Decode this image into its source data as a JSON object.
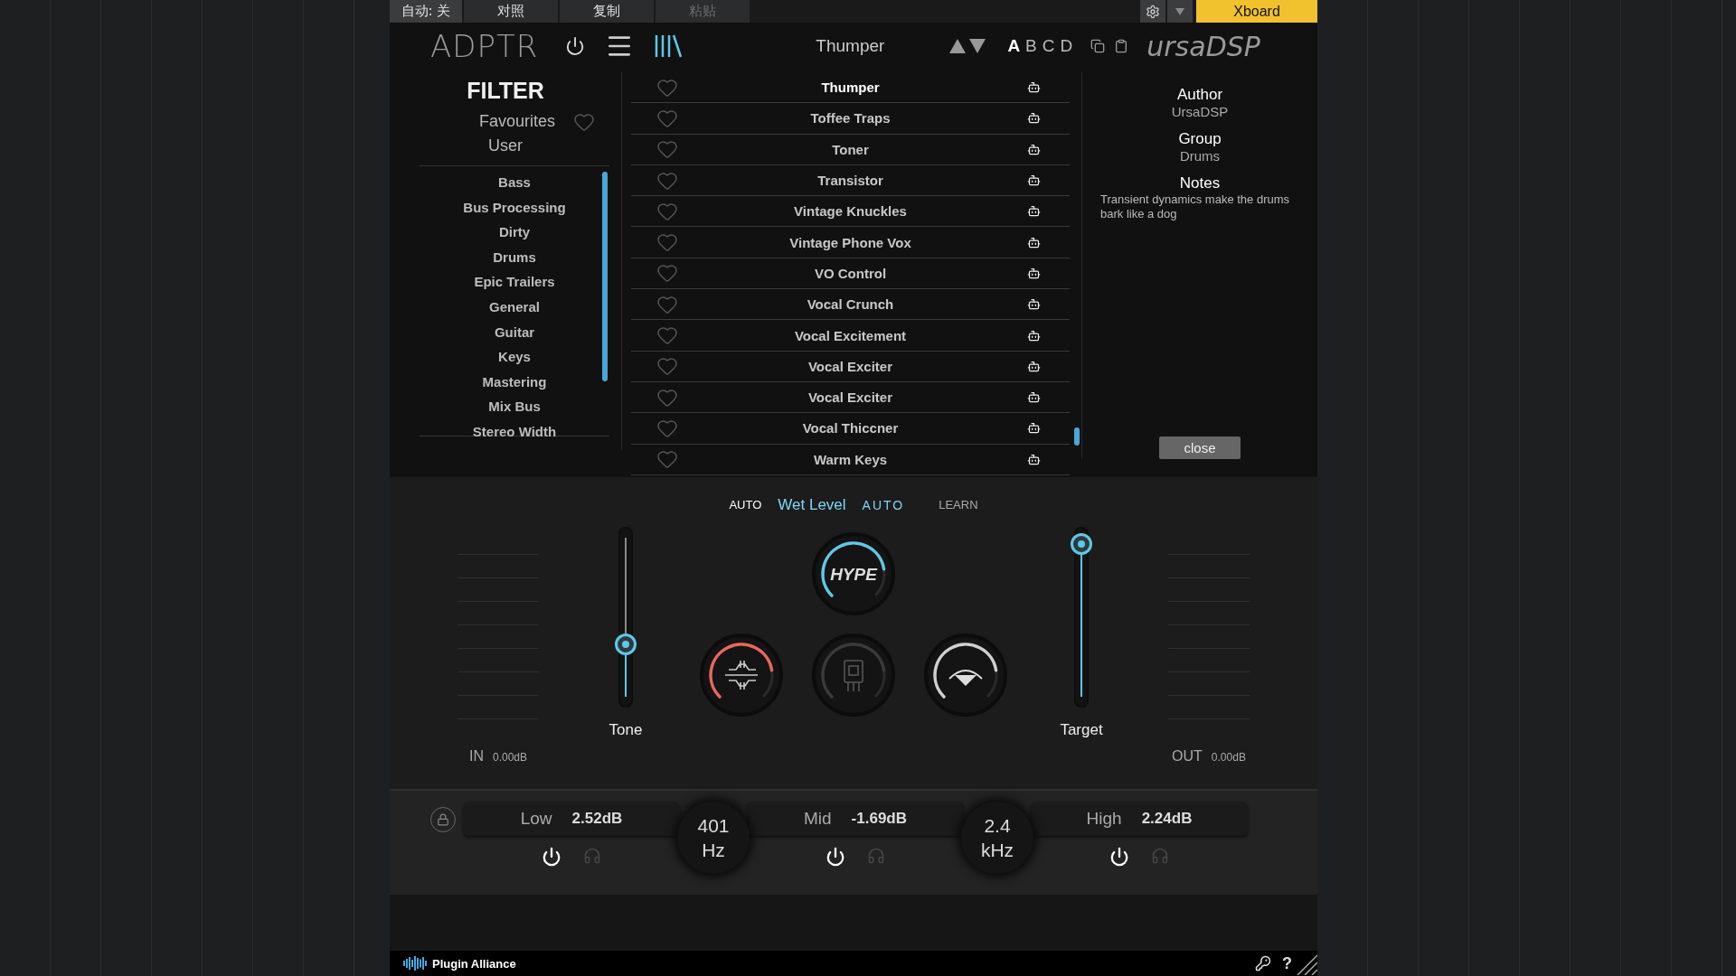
{
  "host_bar": {
    "items": [
      {
        "label": "自动: 关",
        "disabled": false
      },
      {
        "label": "对照",
        "disabled": false
      },
      {
        "label": "复制",
        "disabled": false
      },
      {
        "label": "粘贴",
        "disabled": true
      }
    ],
    "preset_button": "Xboard"
  },
  "header": {
    "logo": "ADPTR",
    "preset_name": "Thumper",
    "slots": [
      {
        "label": "A",
        "selected": true
      },
      {
        "label": "B",
        "selected": false
      },
      {
        "label": "C",
        "selected": false
      },
      {
        "label": "D",
        "selected": false
      }
    ],
    "brand": "ursaDSP"
  },
  "filter": {
    "title": "FILTER",
    "favourites": "Favourites",
    "user": "User",
    "categories": [
      {
        "label": "Bass",
        "selected": false
      },
      {
        "label": "Bus Processing",
        "selected": false
      },
      {
        "label": "Dirty",
        "selected": false
      },
      {
        "label": "Drums",
        "selected": false
      },
      {
        "label": "Epic Trailers",
        "selected": false
      },
      {
        "label": "General",
        "selected": false
      },
      {
        "label": "Guitar",
        "selected": false
      },
      {
        "label": "Keys",
        "selected": false
      },
      {
        "label": "Mastering",
        "selected": false
      },
      {
        "label": "Mix Bus",
        "selected": false
      },
      {
        "label": "Stereo Width",
        "selected": false
      }
    ]
  },
  "presets": [
    {
      "name": "Thumper",
      "selected": true
    },
    {
      "name": "Toffee Traps",
      "selected": false
    },
    {
      "name": "Toner",
      "selected": false
    },
    {
      "name": "Transistor",
      "selected": false
    },
    {
      "name": "Vintage Knuckles",
      "selected": false
    },
    {
      "name": "Vintage Phone Vox",
      "selected": false
    },
    {
      "name": "VO Control",
      "selected": false
    },
    {
      "name": "Vocal Crunch",
      "selected": false
    },
    {
      "name": "Vocal Excitement",
      "selected": false
    },
    {
      "name": "Vocal Exciter",
      "selected": false
    },
    {
      "name": "Vocal Exciter",
      "selected": false
    },
    {
      "name": "Vocal Thiccner",
      "selected": false
    },
    {
      "name": "Warm Keys",
      "selected": false
    }
  ],
  "info": {
    "author_label": "Author",
    "author": "UrsaDSP",
    "group_label": "Group",
    "group": "Drums",
    "notes_label": "Notes",
    "notes": "Transient dynamics make the drums bark like a dog",
    "close": "close"
  },
  "controls": {
    "auto_left": "AUTO",
    "wet_label": "Wet Level",
    "auto_right": "AUTO",
    "learn": "LEARN",
    "input": {
      "label": "IN",
      "reading": "0.00dB"
    },
    "output": {
      "label": "OUT",
      "reading": "0.00dB"
    },
    "tone": {
      "label": "Tone",
      "level": 0.33
    },
    "target": {
      "label": "Target",
      "level": 0.96
    },
    "knobs": [
      {
        "kind": "hype",
        "label": "HYPE",
        "color": "#5fc8e6"
      },
      {
        "kind": "filter",
        "color": "#e8675f"
      },
      {
        "kind": "tube",
        "color": "#3a3a3a"
      },
      {
        "kind": "curve",
        "color": "#d0d0d0"
      }
    ]
  },
  "bands": [
    {
      "label": "Low",
      "reading": "2.52dB",
      "on": true,
      "solo": false
    },
    {
      "label": "Mid",
      "reading": "-1.69dB",
      "on": true,
      "solo": false
    },
    {
      "label": "High",
      "reading": "2.24dB",
      "on": true,
      "solo": false
    }
  ],
  "crossovers": [
    {
      "value": "401",
      "unit": "Hz"
    },
    {
      "value": "2.4",
      "unit": "kHz"
    }
  ],
  "footer": {
    "brand": "Plugin Alliance",
    "help": "?"
  }
}
